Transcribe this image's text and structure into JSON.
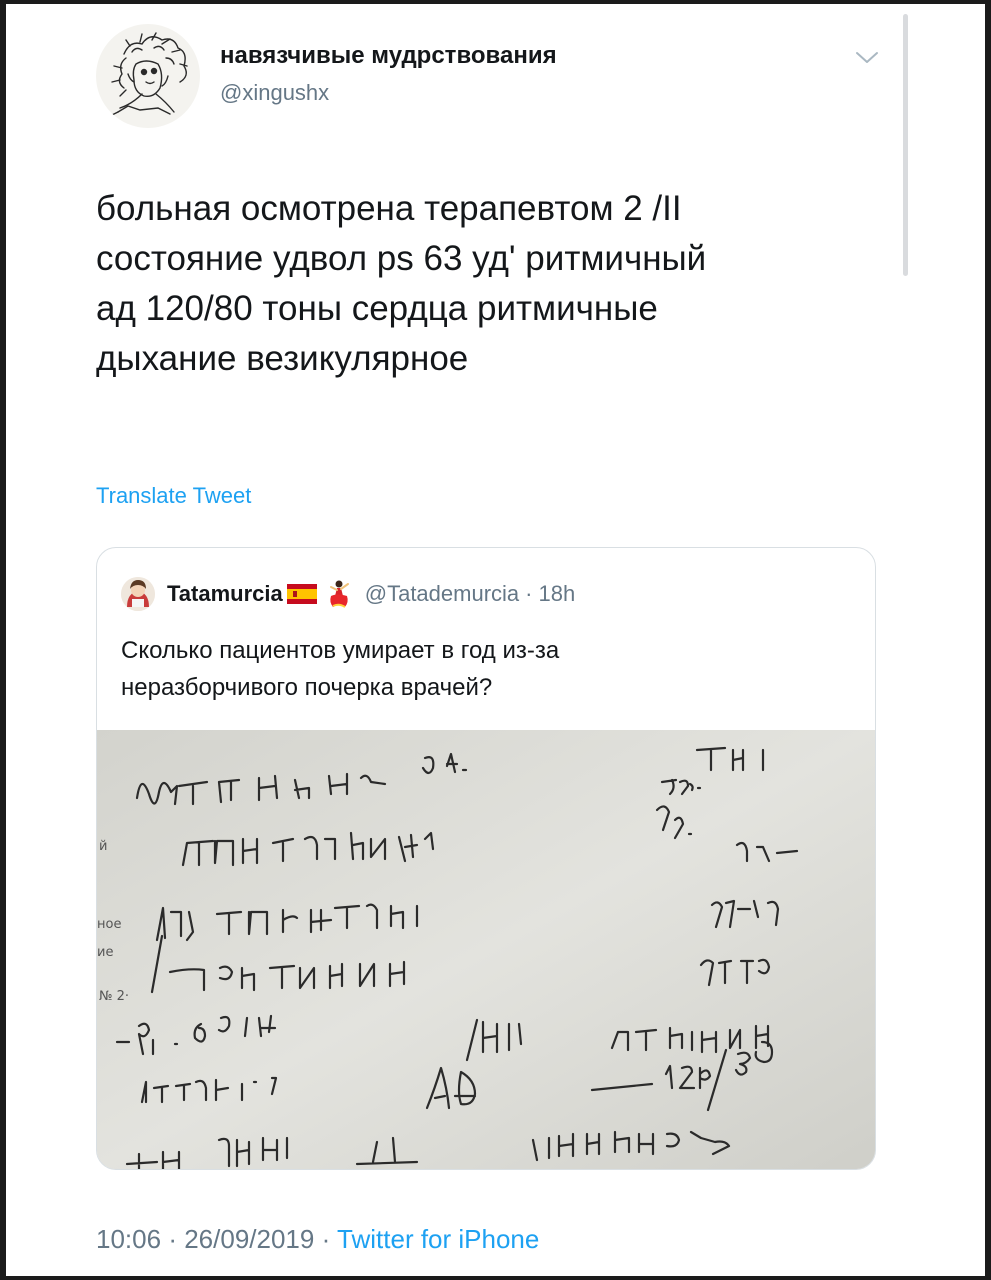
{
  "tweet": {
    "author_name": "навязчивые мудрствования",
    "author_handle": "@xingushx",
    "text_lines": [
      "больная осмотрена терапевтом 2 /II",
      "состояние удвол ps 63 уд' ритмичный",
      "ад 120/80 тоны сердца ритмичные",
      "дыхание везикулярное"
    ],
    "translate_label": "Translate Tweet",
    "time": "10:06",
    "date": "26/09/2019",
    "separator": "·",
    "source": "Twitter for iPhone"
  },
  "quoted": {
    "author_name": "Tatamurcia",
    "author_handle": "@Tatademurcia",
    "separator": "·",
    "age": "18h",
    "text_lines": [
      "Сколько пациентов умирает в год из-за",
      "неразборчивого почерка врачей?"
    ],
    "image": {
      "description_icon": "handwritten-note-image",
      "margin_labels": [
        "й",
        "ное",
        "ие",
        "№ 2·"
      ]
    }
  },
  "icons": {
    "menu": "chevron-down-icon",
    "avatar": "sketch-avatar",
    "flag": "spain-flag-icon",
    "dancer": "flamenco-dancer-icon"
  },
  "colors": {
    "link": "#1da1f2",
    "secondary_text": "#657786",
    "primary_text": "#14171a",
    "card_border": "#d9dfe3"
  }
}
